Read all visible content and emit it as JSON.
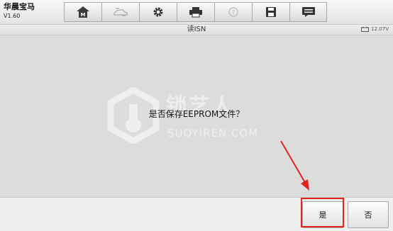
{
  "app": {
    "title": "华晨宝马",
    "version": "V1.60"
  },
  "toolbar": {
    "buttons": [
      {
        "icon": "home-icon"
      },
      {
        "icon": "vehicle-swap-icon"
      },
      {
        "icon": "gear-icon"
      },
      {
        "icon": "printer-icon"
      },
      {
        "icon": "help-icon"
      },
      {
        "icon": "save-icon"
      },
      {
        "icon": "message-icon"
      }
    ]
  },
  "subheader": {
    "title": "读ISN",
    "battery_voltage": "12.07V"
  },
  "watermark": {
    "brand": "锁艺人",
    "url": "SUOYIREN.COM"
  },
  "dialog": {
    "message": "是否保存EEPROM文件？"
  },
  "footer": {
    "yes_label": "是",
    "no_label": "否"
  },
  "colors": {
    "highlight": "#e02424",
    "main_bg": "#dcdcdc"
  }
}
